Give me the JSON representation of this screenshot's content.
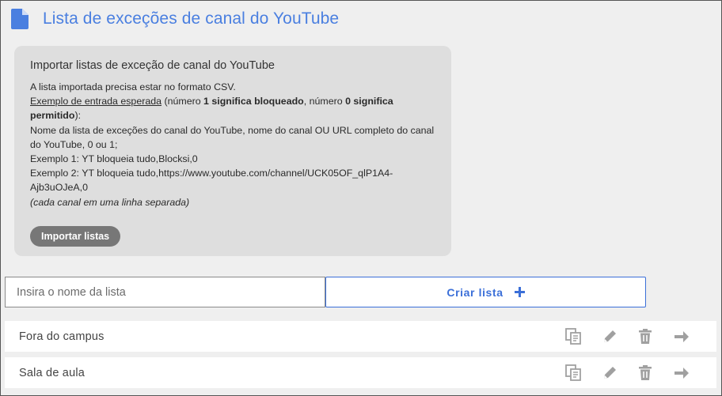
{
  "header": {
    "title": "Lista de exceções de canal do YouTube",
    "icon": "document-icon"
  },
  "import_panel": {
    "title": "Importar listas de exceção de canal do YouTube",
    "line_format": "A lista importada precisa estar no formato CSV.",
    "example_label": "Exemplo de entrada esperada",
    "example_text_1": " (número ",
    "example_bold_1": "1 significa bloqueado",
    "example_text_2": ", número ",
    "example_bold_2": "0 significa permitido",
    "example_text_3": "):",
    "line_schema": "Nome da lista de exceções do canal do YouTube, nome do canal OU URL completo do canal do YouTube, 0 ou 1;",
    "line_example_1": "Exemplo 1: YT bloqueia tudo,Blocksi,0",
    "line_example_2": "Exemplo 2: YT bloqueia tudo,https://www.youtube.com/channel/UCK05OF_qlP1A4-Ajb3uOJeA,0",
    "line_note": "(cada canal em uma linha separada)",
    "import_button": "Importar listas"
  },
  "create": {
    "input_placeholder": "Insira o nome da lista",
    "input_value": "",
    "button_label": "Criar lista",
    "button_icon": "plus-icon"
  },
  "lists": [
    {
      "name": "Fora do campus"
    },
    {
      "name": "Sala de aula"
    }
  ],
  "row_action_icons": [
    "copy-icon",
    "pencil-icon",
    "trash-icon",
    "arrow-right-icon"
  ],
  "colors": {
    "accent": "#4a7fe0",
    "button_gray": "#777777",
    "panel_bg": "#dedede",
    "page_bg": "#efefef",
    "icon_gray": "#a0a0a0"
  }
}
